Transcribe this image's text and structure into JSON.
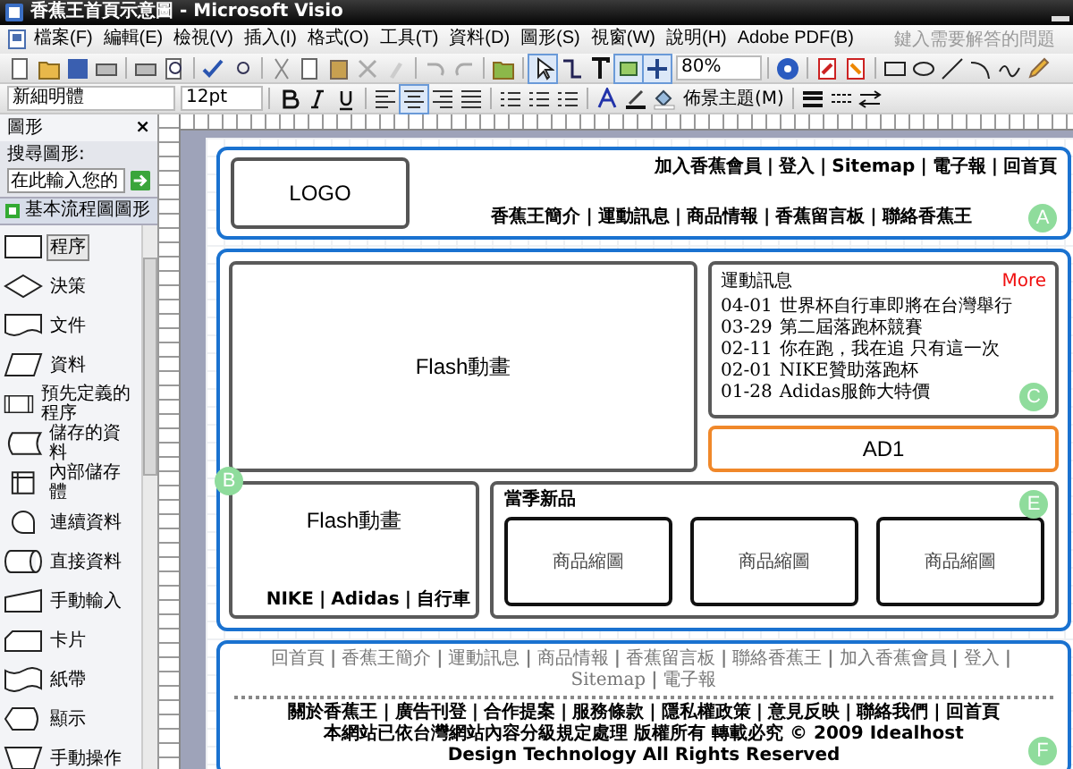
{
  "window": {
    "title": "香蕉王首頁示意圖 - Microsoft Visio"
  },
  "menu": [
    "檔案(F)",
    "編輯(E)",
    "檢視(V)",
    "插入(I)",
    "格式(O)",
    "工具(T)",
    "資料(D)",
    "圖形(S)",
    "視窗(W)",
    "說明(H)",
    "Adobe PDF(B)"
  ],
  "help_box": {
    "placeholder": "鍵入需要解答的問題"
  },
  "toolbar": {
    "zoom": "80%",
    "font": "新細明體",
    "font_size": "12pt",
    "theme_button": "佈景主題(M)"
  },
  "shapes_panel": {
    "title": "圖形",
    "close": "×",
    "search_label": "搜尋圖形:",
    "search_placeholder": "在此輸入您的",
    "stencil": "基本流程圖圖形",
    "shapes": [
      {
        "label": "程序",
        "kind": "process",
        "selected": true
      },
      {
        "label": "決策",
        "kind": "decision",
        "selected": false
      },
      {
        "label": "文件",
        "kind": "document",
        "selected": false
      },
      {
        "label": "資料",
        "kind": "data",
        "selected": false
      },
      {
        "label": "預先定義的程序",
        "kind": "predefined",
        "selected": false
      },
      {
        "label": "儲存的資料",
        "kind": "stored",
        "selected": false
      },
      {
        "label": "內部儲存體",
        "kind": "internal",
        "selected": false
      },
      {
        "label": "連續資料",
        "kind": "sequential",
        "selected": false
      },
      {
        "label": "直接資料",
        "kind": "direct",
        "selected": false
      },
      {
        "label": "手動輸入",
        "kind": "manual_input",
        "selected": false
      },
      {
        "label": "卡片",
        "kind": "card",
        "selected": false
      },
      {
        "label": "紙帶",
        "kind": "tape",
        "selected": false
      },
      {
        "label": "顯示",
        "kind": "display",
        "selected": false
      },
      {
        "label": "手動操作",
        "kind": "manual_op",
        "selected": false
      }
    ]
  },
  "page": {
    "separator": "|",
    "header": {
      "logo": "LOGO",
      "marker": "A",
      "top_links": [
        "加入香蕉會員",
        "登入",
        "Sitemap",
        "電子報",
        "回首頁"
      ],
      "nav_links": [
        "香蕉王簡介",
        "運動訊息",
        "商品情報",
        "香蕉留言板",
        "聯絡香蕉王"
      ]
    },
    "main": {
      "flash": "Flash動畫",
      "news": {
        "title": "運動訊息",
        "more": "More",
        "marker": "C",
        "items": [
          {
            "date": "04-01",
            "text": "世界杯自行車即將在台灣舉行"
          },
          {
            "date": "03-29",
            "text": "第二屆落跑杯競賽"
          },
          {
            "date": "02-11",
            "text": "你在跑，我在追 只有這一次"
          },
          {
            "date": "02-01",
            "text": "NIKE贊助落跑杯"
          },
          {
            "date": "01-28",
            "text": "Adidas服飾大特價"
          }
        ]
      },
      "ad": "AD1",
      "flash2": {
        "label": "Flash動畫",
        "marker": "B",
        "links": [
          "NIKE",
          "Adidas",
          "自行車"
        ]
      },
      "products": {
        "title": "當季新品",
        "marker": "E",
        "items": [
          "商品縮圖",
          "商品縮圖",
          "商品縮圖"
        ]
      }
    },
    "footer": {
      "marker": "F",
      "links": [
        "回首頁",
        "香蕉王簡介",
        "運動訊息",
        "商品情報",
        "香蕉留言板",
        "聯絡香蕉王",
        "加入香蕉會員",
        "登入",
        "Sitemap",
        "電子報"
      ],
      "bottom_links": [
        "關於香蕉王",
        "廣告刊登",
        "合作提案",
        "服務條款",
        "隱私權政策",
        "意見反映",
        "聯絡我們",
        "回首頁"
      ],
      "copyright": "本網站已依台灣網站內容分級規定處理 版權所有 轉載必究 © 2009 Idealhost Design Technology All Rights Reserved"
    }
  }
}
